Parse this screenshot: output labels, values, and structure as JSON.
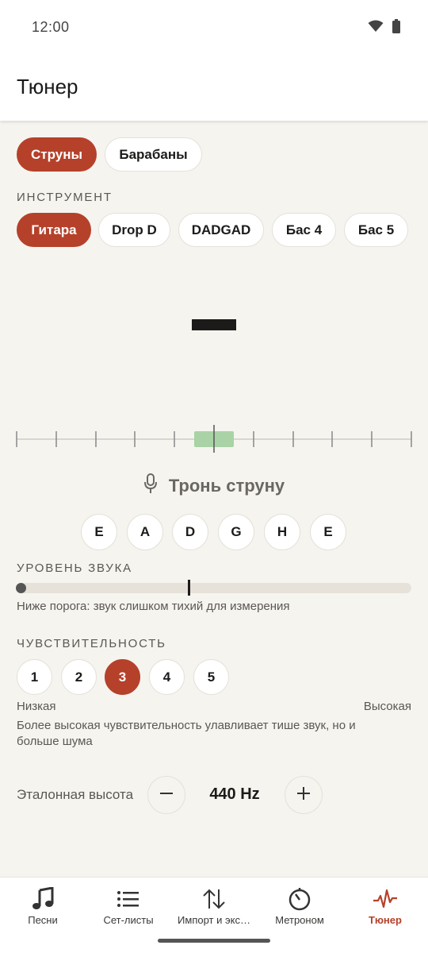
{
  "status_bar": {
    "time": "12:00",
    "icons": [
      "wifi-icon",
      "battery-icon"
    ]
  },
  "app_bar": {
    "title": "Тюнер"
  },
  "mode_tabs": [
    {
      "label": "Струны",
      "active": true
    },
    {
      "label": "Барабаны",
      "active": false
    }
  ],
  "instrument": {
    "section_label": "ИНСТРУМЕНТ",
    "options": [
      {
        "label": "Гитара",
        "active": true
      },
      {
        "label": "Drop D",
        "active": false
      },
      {
        "label": "DADGAD",
        "active": false
      },
      {
        "label": "Бас 4",
        "active": false
      },
      {
        "label": "Бас 5",
        "active": false
      }
    ]
  },
  "tuner": {
    "note_display": "—",
    "prompt": "Тронь струну",
    "strings": [
      "E",
      "A",
      "D",
      "G",
      "H",
      "E"
    ]
  },
  "sound_level": {
    "section_label": "УРОВЕНЬ ЗВУКА",
    "level": 0.0,
    "threshold": 0.44,
    "hint": "Ниже порога: звук слишком тихий для измерения"
  },
  "sensitivity": {
    "section_label": "ЧУВСТВИТЕЛЬНОСТЬ",
    "options": [
      "1",
      "2",
      "3",
      "4",
      "5"
    ],
    "selected": "3",
    "low_label": "Низкая",
    "high_label": "Высокая",
    "hint": "Более высокая чувствительность улавливает тише звук, но и больше шума"
  },
  "reference": {
    "label": "Эталонная высота",
    "value": "440 Hz",
    "decrease_icon": "minus-icon",
    "increase_icon": "plus-icon"
  },
  "bottom_nav": [
    {
      "label": "Песни",
      "icon": "music-note-icon",
      "active": false
    },
    {
      "label": "Сет-листы",
      "icon": "list-icon",
      "active": false
    },
    {
      "label": "Импорт и экс…",
      "icon": "import-export-icon",
      "active": false
    },
    {
      "label": "Метроном",
      "icon": "metronome-icon",
      "active": false
    },
    {
      "label": "Тюнер",
      "icon": "tuner-wave-icon",
      "active": true
    }
  ],
  "colors": {
    "accent": "#b5412a",
    "background": "#f6f4ef",
    "in_tune_zone": "#a9d3a6"
  }
}
